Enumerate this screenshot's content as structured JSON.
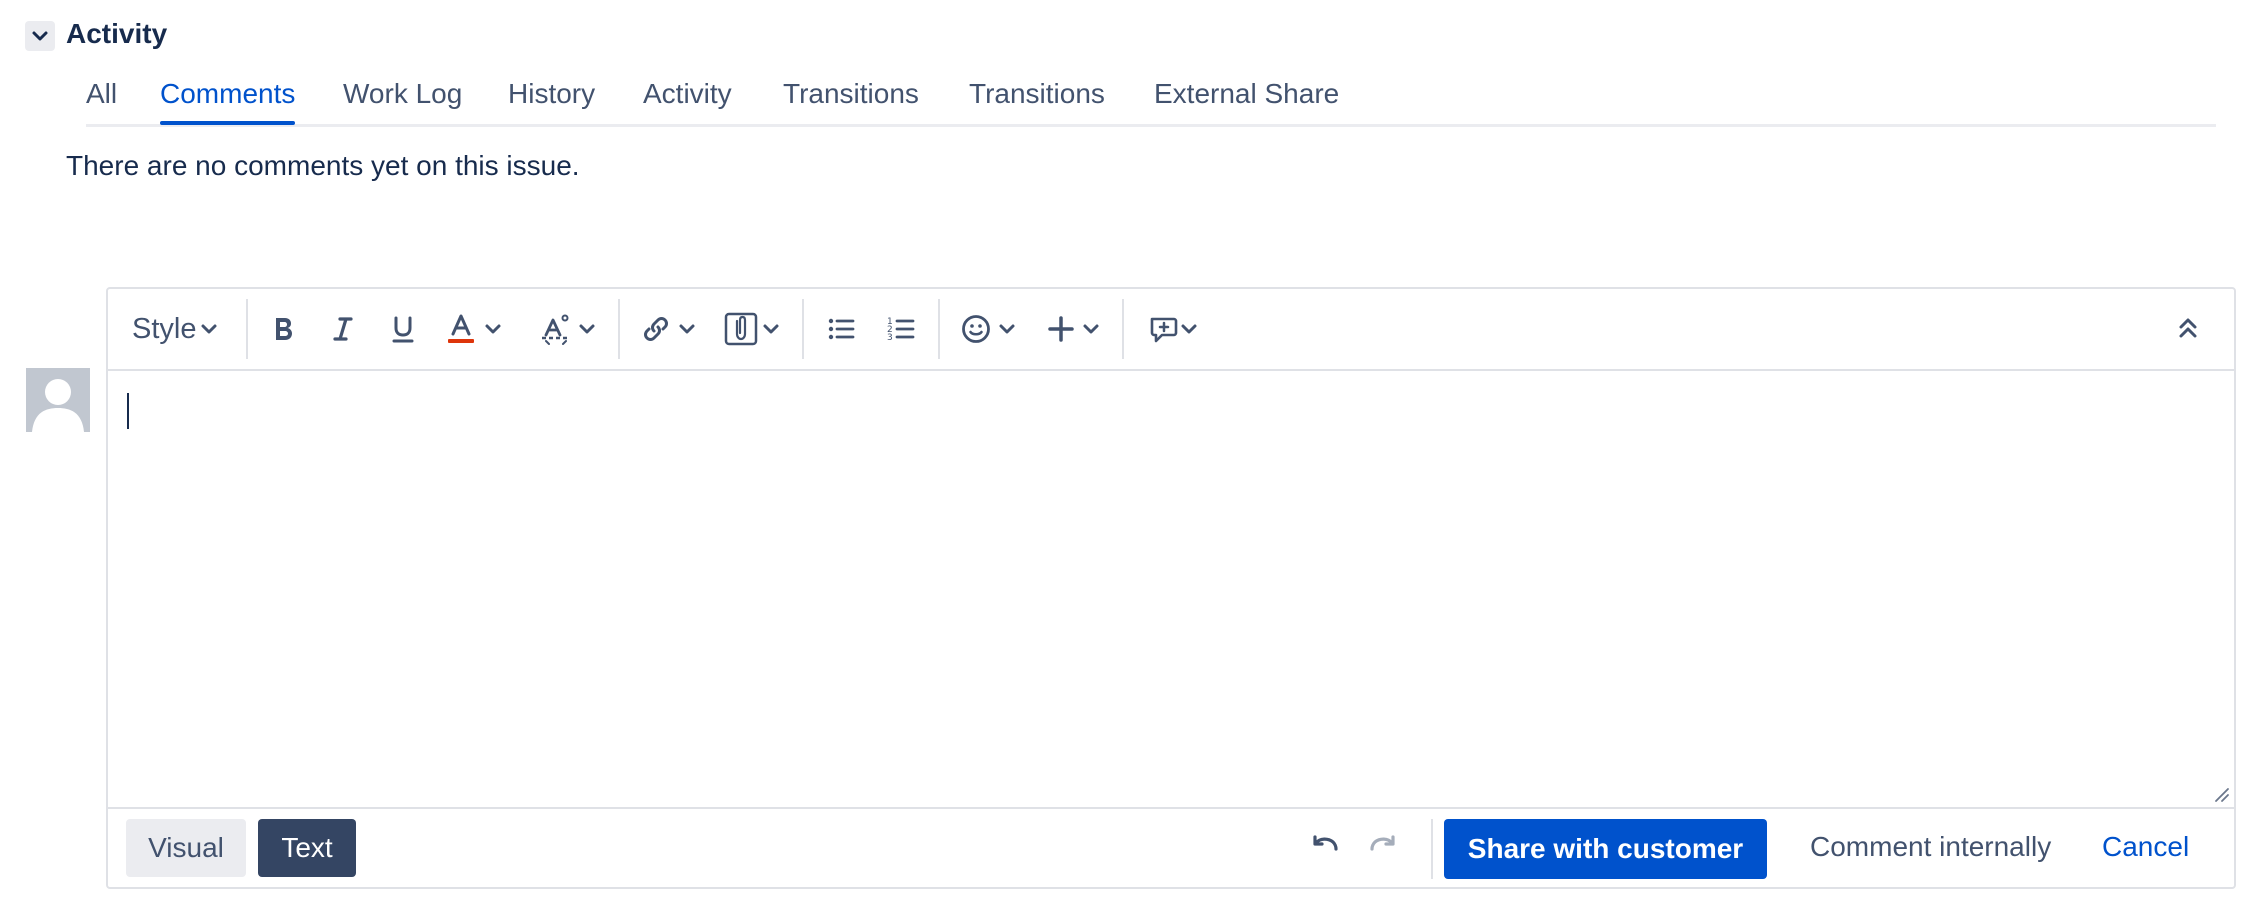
{
  "activity": {
    "title": "Activity",
    "collapse_icon": "chevron-down-icon"
  },
  "tabs": [
    {
      "label": "All",
      "active": false
    },
    {
      "label": "Comments",
      "active": true
    },
    {
      "label": "Work Log",
      "active": false
    },
    {
      "label": "History",
      "active": false
    },
    {
      "label": "Activity",
      "active": false
    },
    {
      "label": "Transitions",
      "active": false
    },
    {
      "label": "Transitions",
      "active": false
    },
    {
      "label": "External Share",
      "active": false
    }
  ],
  "empty_message": "There are no comments yet on this issue.",
  "editor": {
    "toolbar": {
      "style_label": "Style",
      "icons": [
        "bold-icon",
        "italic-icon",
        "underline-icon",
        "text-color-icon",
        "clear-format-icon",
        "link-icon",
        "attachment-icon",
        "bullet-list-icon",
        "numbered-list-icon",
        "emoji-icon",
        "insert-more-icon",
        "comment-macro-icon",
        "collapse-toolbar-icon"
      ],
      "text_color_accent": "#de350b"
    },
    "content": ""
  },
  "footer": {
    "visual_label": "Visual",
    "text_label": "Text",
    "share_label": "Share with customer",
    "internal_label": "Comment internally",
    "cancel_label": "Cancel"
  },
  "colors": {
    "primary": "#0052cc",
    "text": "#172b4d",
    "subtle_text": "#42526e",
    "border": "#dfe1e6",
    "dark_button": "#344563"
  }
}
